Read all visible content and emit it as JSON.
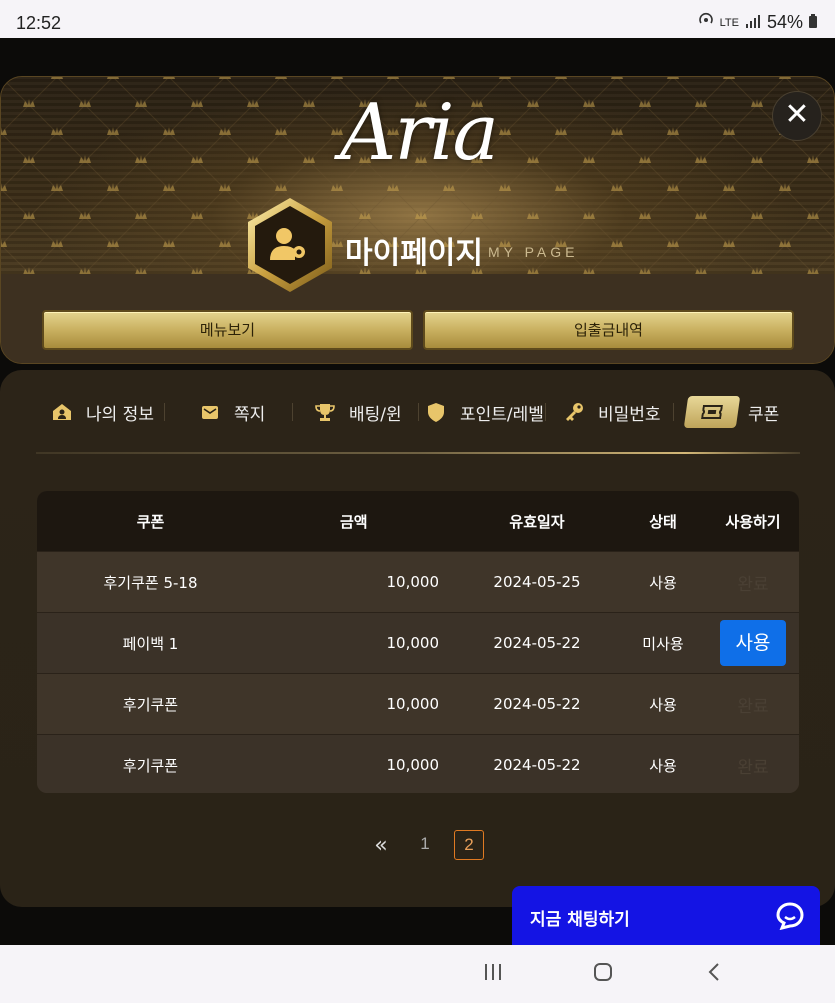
{
  "status_bar": {
    "time": "12:52",
    "network": "LTE",
    "battery": "54%"
  },
  "header": {
    "logo": "Aria",
    "title": "마이페이지",
    "subtitle": "MY PAGE",
    "close_icon": "close-icon"
  },
  "actions": {
    "menu_label": "메뉴보기",
    "deposit_label": "입출금내역"
  },
  "tabs": [
    {
      "label": "나의 정보",
      "icon": "home-user-icon"
    },
    {
      "label": "쪽지",
      "icon": "mail-icon"
    },
    {
      "label": "배팅/윈",
      "icon": "trophy-icon"
    },
    {
      "label": "포인트/레벨",
      "icon": "shield-icon"
    },
    {
      "label": "비밀번호",
      "icon": "key-icon"
    },
    {
      "label": "쿠폰",
      "icon": "ticket-icon",
      "active": true
    }
  ],
  "table": {
    "headers": [
      "쿠폰",
      "금액",
      "유효일자",
      "상태",
      "사용하기"
    ],
    "rows": [
      {
        "coupon": "후기쿠폰 5-18",
        "amount": "10,000",
        "date": "2024-05-25",
        "status": "사용",
        "action": "완료"
      },
      {
        "coupon": "페이백 1",
        "amount": "10,000",
        "date": "2024-05-22",
        "status": "미사용",
        "action": "사용"
      },
      {
        "coupon": "후기쿠폰",
        "amount": "10,000",
        "date": "2024-05-22",
        "status": "사용",
        "action": "완료"
      },
      {
        "coupon": "후기쿠폰",
        "amount": "10,000",
        "date": "2024-05-22",
        "status": "사용",
        "action": "완료"
      }
    ]
  },
  "pagination": {
    "prev": "«",
    "pages": [
      "1",
      "2"
    ],
    "current": "2"
  },
  "chat": {
    "label": "지금 채팅하기"
  },
  "colors": {
    "gold": "#c9b060",
    "use_button": "#0f6fe8",
    "chat": "#1414e4",
    "active_page": "#e07a22"
  }
}
